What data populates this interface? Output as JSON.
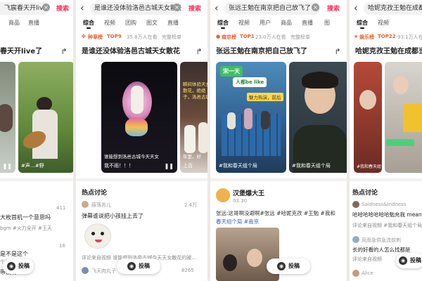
{
  "panel1": {
    "search_value": "飞宸春天开live了",
    "search_button": "搜索",
    "tabs": [
      "商品",
      "直播"
    ],
    "title": "春天开live了",
    "video_caption": "#声…#野",
    "comment_count_1": "411",
    "comment_1": "大枚首机一个意思吗",
    "comment_1_tag": "bgm #火力全开 #王天",
    "comment_count_2": "16",
    "comment_2": "是不是这个",
    "comment_2_tag": "个局",
    "comment_3": "带没有1",
    "post_button": "投稿"
  },
  "panel2": {
    "search_value": "是谁还没体验洛邑古城天女散花",
    "search_button": "搜索",
    "tabs": [
      "综合",
      "视频",
      "团购",
      "图文",
      "直播"
    ],
    "rank_name": "种草榜",
    "rank_no": "TOP9",
    "rank_heat": "35.8万人在看",
    "rank_full": "完整榜单",
    "title": "是谁还没体验洛邑古城天女散花",
    "video1_caption": "谁能想到洛邑古城今天天女",
    "video1_foot": "我不雨！！！",
    "video2_caption": "瞬间体验天女散花，绝绝子，洛邑古城",
    "video2_caption2": "哈爸，那真的，好",
    "video2_foot": "年里，好",
    "video2_foot2": "上百",
    "hot_title": "热点讨论",
    "c1_user": "薛落苏儿",
    "c1_likes": "2.4万",
    "c1_text": "弹幕谁说把小孩挂上去了",
    "c2_tag": "评论来自视频  谁能想到洛邑古城今天天女散花的被…",
    "c2_user": "飞天肉丸子",
    "c2_likes": "8265",
    "post_button": "投稿"
  },
  "panel3": {
    "search_value": "张远王勉在南京把自己放飞了",
    "search_button": "搜索",
    "tabs": [
      "综合",
      "视频",
      "用户",
      "商品",
      "直播",
      "图"
    ],
    "rank_name": "南京榜",
    "rank_no": "TOP1",
    "rank_heat": "23.0万人在看",
    "rank_full": "完整榜单",
    "title": "张远王勉在南京把自己放飞了",
    "video1_banner": "宋一天",
    "video1_banner2": "人都be like",
    "video1_caption": "魅力热演，前后",
    "video1_foot": "#我和春天组个局",
    "video2_caption": "",
    "video2_foot": "#我和春天组个局",
    "author_name": "汉堡爆大王",
    "author_time": "03.30",
    "body_line1": "张远:这哥啊没避啊#张远 #哈妮克孜 #王勉 #我和",
    "body_line2": "春天组个局 #南京",
    "post_button": "投稿"
  },
  "panel4": {
    "search_value": "哈妮克孜王勉在成都",
    "tabs": [
      "综合",
      "视频"
    ],
    "rank_name": "娱乐榜",
    "rank_no": "TOP22",
    "rank_heat": "93.1万人在看",
    "title": "哈妮克孜王勉在成都当rap",
    "video_caption": "#我和春天组个",
    "hot_title": "热点讨论",
    "c1_user": "Saidness&indness",
    "c1_text": "哈哈哈哈哈哈哈勉充我 mean",
    "c1_tag": "评论来自视频  #我和春天组个局",
    "c2_user": "风雨急供急流前刺",
    "c2_text": "长的好看的人怎么找都是",
    "c2_tag": "评论来自视频",
    "c3_user": "Alice",
    "post_button": "投稿"
  }
}
